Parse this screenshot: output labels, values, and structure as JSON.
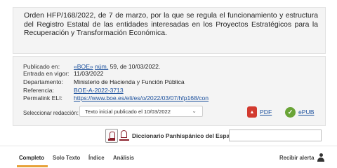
{
  "document": {
    "title": "Orden HFP/168/2022, de 7 de marzo, por la que se regula el funcionamiento y estructura del Registro Estatal de las entidades interesadas en los Proyectos Estratégicos para la Recuperación y Transformación Económica."
  },
  "meta": {
    "publicado_label": "Publicado en:",
    "publicado_link": "«BOE»",
    "publicado_num": "núm.",
    "publicado_rest": "59, de 10/03/2022.",
    "vigor_label": "Entrada en vigor:",
    "vigor_value": "11/03/2022",
    "departamento_label": "Departamento:",
    "departamento_value": "Ministerio de Hacienda y Función Pública",
    "referencia_label": "Referencia:",
    "referencia_value": "BOE-A-2022-3713",
    "eli_label": "Permalink ELI:",
    "eli_value": "https://www.boe.es/eli/es/o/2022/03/07/hfp168/con"
  },
  "redaccion": {
    "label": "Seleccionar redacción:",
    "selected": "Texto inicial publicado el 10/03/2022"
  },
  "downloads": {
    "pdf_label": "PDF",
    "epub_label": "ePUB"
  },
  "dictionary": {
    "label": "Diccionario Panhispánico del Español Jurídico",
    "input_value": ""
  },
  "tabs": [
    {
      "label": "Completo"
    },
    {
      "label": "Solo Texto"
    },
    {
      "label": "Índice"
    },
    {
      "label": "Análisis"
    }
  ],
  "alerta": {
    "label": "Recibir alerta"
  },
  "colors": {
    "link": "#1a4f9c",
    "active_tab_accent": "#e7a23a",
    "pdf": "#d23a2f",
    "epub": "#6aa437"
  }
}
